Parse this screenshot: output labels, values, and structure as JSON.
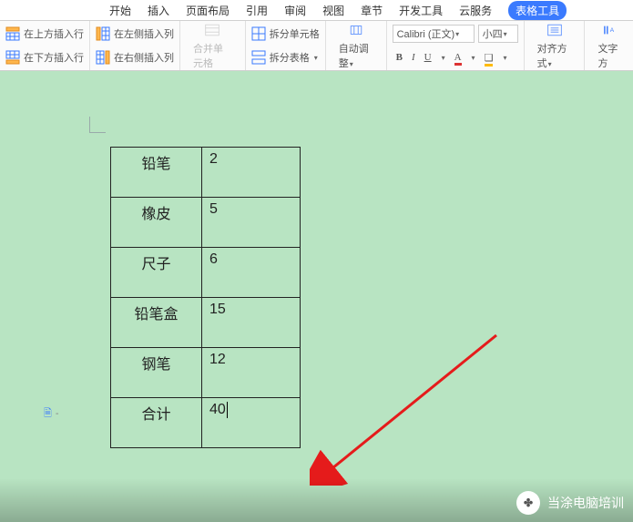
{
  "tabs": {
    "start": "开始",
    "insert": "插入",
    "layout": "页面布局",
    "ref": "引用",
    "review": "审阅",
    "view": "视图",
    "chapter": "章节",
    "dev": "开发工具",
    "cloud": "云服务",
    "table_tools": "表格工具"
  },
  "ribbon": {
    "ins_row_above": "在上方插入行",
    "ins_row_below": "在下方插入行",
    "ins_col_left": "在左侧插入列",
    "ins_col_right": "在右侧插入列",
    "merge_cells": "合并单元格",
    "split_cells": "拆分单元格",
    "split_table": "拆分表格",
    "autofit": "自动调整",
    "font_name": "Calibri (正文)",
    "font_size": "小四",
    "align": "对齐方式",
    "text_dir": "文字方"
  },
  "table": {
    "rows": [
      {
        "name": "铅笔",
        "value": "2"
      },
      {
        "name": "橡皮",
        "value": "5"
      },
      {
        "name": "尺子",
        "value": "6"
      },
      {
        "name": "铅笔盒",
        "value": "15"
      },
      {
        "name": "钢笔",
        "value": "12"
      },
      {
        "name": "合计",
        "value": "40"
      }
    ]
  },
  "watermark": {
    "text": "当涂电脑培训"
  }
}
